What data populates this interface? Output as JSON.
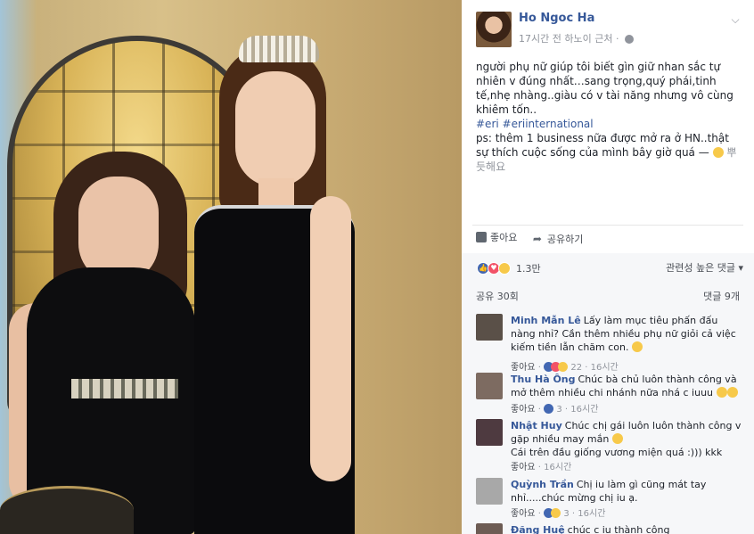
{
  "post": {
    "author": "Ho Ngoc Ha",
    "meta": "17시간 전 하노이 근처 ·",
    "text_1": "người phụ nữ giúp tôi biết gìn giữ nhan sắc tự nhiên v đúng nhất…sang trọng,quý phái,tinh tế,nhẹ nhàng..giàu có v tài năng nhưng vô cùng khiêm tốn..",
    "hashtags": "#eri #eriinternational",
    "text_2": "ps: thêm 1 business nữa được mở ra ở HN..thật sự thích cuộc sống của mình bây giờ quá —",
    "feeling": "뿌듯해요"
  },
  "actions": {
    "like_label": "좋아요",
    "share_label": "공유하기"
  },
  "reactions": {
    "count": "1.3만",
    "sort_label": "관련성 높은 댓글 ▾",
    "shares": "공유 30회",
    "comments_count": "댓글 9개"
  },
  "comments": [
    {
      "name": "Minh Mẫn Lê",
      "text": "Lấy làm mục tiêu phấn đấu nàng nhỉ? Cần thêm nhiều phụ nữ giỏi cả việc kiếm tiền lẫn chăm con.",
      "like_label": "좋아요",
      "reaction_count": "22",
      "time": "16시간"
    },
    {
      "name": "Thu Hà Ông",
      "text": "Chúc bà chủ luôn thành công và mở thêm nhiều chi nhánh nữa nhá c iuuu",
      "like_label": "좋아요",
      "reaction_count": "3",
      "time": "16시간"
    },
    {
      "name": "Nhật Huy",
      "text": "Chúc chị gái luôn luôn thành công v gặp nhiều may mắn",
      "text_2": "Cái trên đầu giống vương miện quá :))) kkk",
      "like_label": "좋아요",
      "time": "16시간"
    },
    {
      "name": "Quỳnh Trần",
      "text": "Chị iu làm gì cũng mát tay nhỉ.....chúc mừng chị iu ạ.",
      "like_label": "좋아요",
      "reaction_count": "3",
      "time": "16시간"
    },
    {
      "name": "Đăng Huệ",
      "text": "chúc c iu thành công"
    }
  ],
  "colors": {
    "link": "#365899",
    "meta": "#90949c",
    "like_reaction": "#4267b2",
    "love_reaction": "#f25268",
    "haha_reaction": "#f7c94a"
  }
}
